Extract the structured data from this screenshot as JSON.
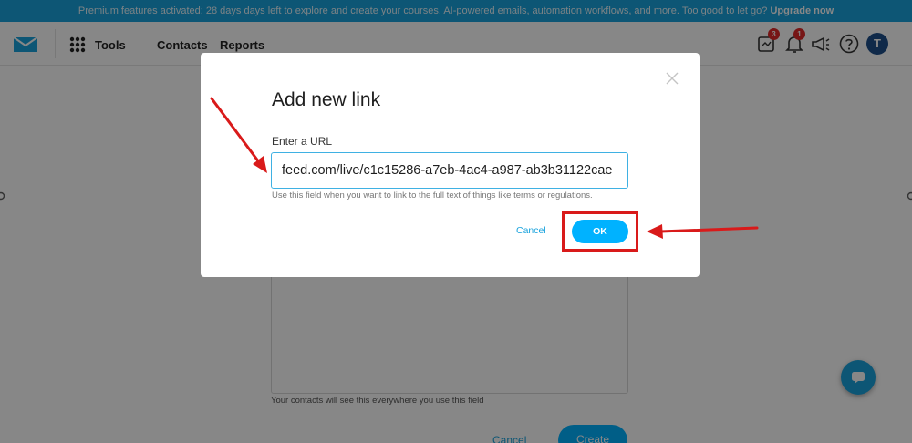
{
  "banner": {
    "text": "Premium features activated: 28 days days left to explore and create your courses, AI-powered emails, automation workflows, and more. Too good to let go? ",
    "link": "Upgrade now"
  },
  "nav": {
    "tools": "Tools",
    "contacts": "Contacts",
    "reports": "Reports",
    "messages_badge": "3",
    "notifications_badge": "1",
    "avatar_initial": "T"
  },
  "background_form": {
    "hint": "Your contacts will see this everywhere you use this field",
    "cancel": "Cancel",
    "create": "Create"
  },
  "modal": {
    "title": "Add new link",
    "url_label": "Enter a URL",
    "url_value": "feed.com/live/c1c15286-a7eb-4ac4-a987-ab3b31122cae",
    "url_hint": "Use this field when you want to link to the full text of things like terms or regulations.",
    "cancel": "Cancel",
    "ok": "OK"
  },
  "colors": {
    "accent": "#1aa3dd",
    "button": "#00b2ff",
    "annotation": "#d91a1a",
    "badge": "#e02a2a"
  },
  "icons": [
    "email-logo-icon",
    "apps-grid-icon",
    "messages-icon",
    "bell-icon",
    "megaphone-icon",
    "help-icon",
    "chat-icon",
    "close-icon"
  ]
}
